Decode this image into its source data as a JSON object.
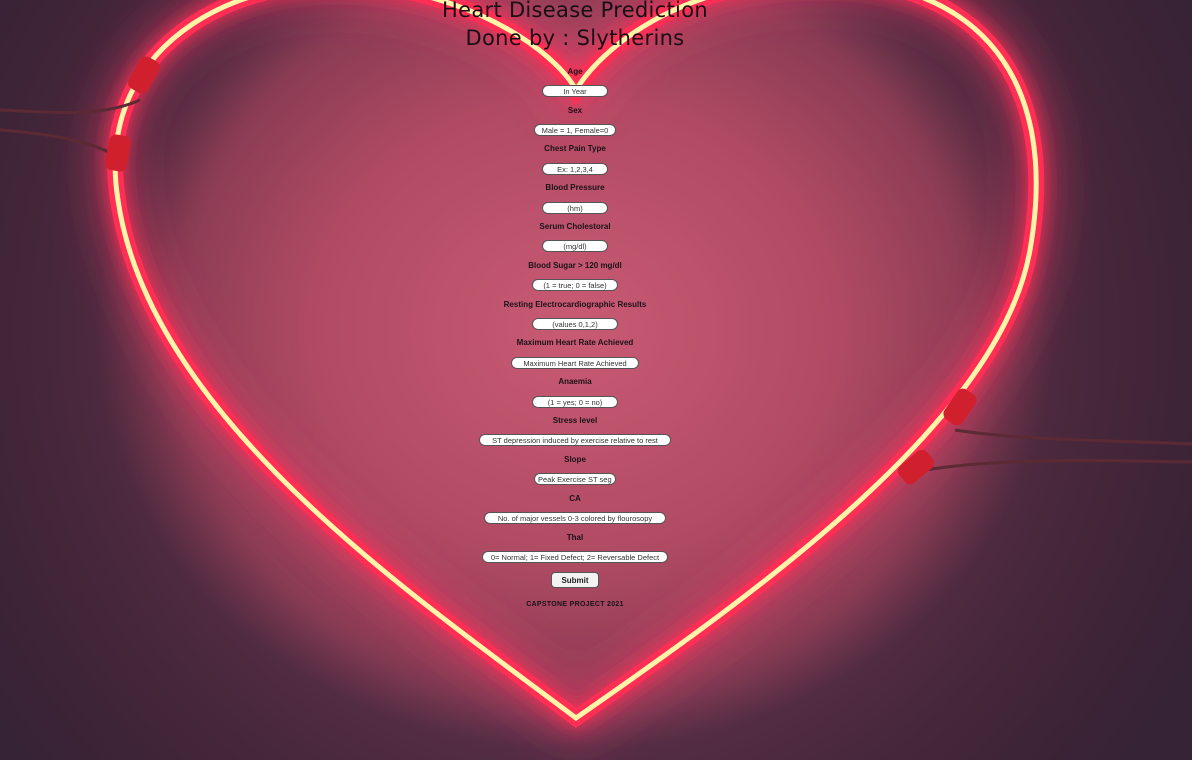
{
  "header": {
    "title": "Heart Disease Prediction",
    "subtitle": "Done by : Slytherins"
  },
  "form": {
    "fields": [
      {
        "label": "Age",
        "placeholder": "In Year"
      },
      {
        "label": "Sex",
        "placeholder": "Male = 1, Female=0"
      },
      {
        "label": "Chest Pain Type",
        "placeholder": "Ex: 1,2,3,4"
      },
      {
        "label": "Blood Pressure",
        "placeholder": "(hm)"
      },
      {
        "label": "Serum Cholestoral",
        "placeholder": "(mg/dl)"
      },
      {
        "label": "Blood Sugar > 120 mg/dl",
        "placeholder": "(1 = true; 0 = false)"
      },
      {
        "label": "Resting Electrocardiographic Results",
        "placeholder": "(values 0,1,2)"
      },
      {
        "label": "Maximum Heart Rate Achieved",
        "placeholder": "Maximum Heart Rate Achieved"
      },
      {
        "label": "Anaemia",
        "placeholder": "(1 = yes; 0 = no)"
      },
      {
        "label": "Stress level",
        "placeholder": "ST depression induced by exercise relative to rest"
      },
      {
        "label": "Slope",
        "placeholder": "Peak Exercise ST segment"
      },
      {
        "label": "CA",
        "placeholder": "No. of major vessels 0-3 colored by flourosopy"
      },
      {
        "label": "Thal",
        "placeholder": "0= Normal; 1= Fixed Defect; 2= Reversable Defect"
      }
    ],
    "submit_label": "Submit"
  },
  "footer": {
    "text": "CAPSTONE PROJECT 2021"
  }
}
